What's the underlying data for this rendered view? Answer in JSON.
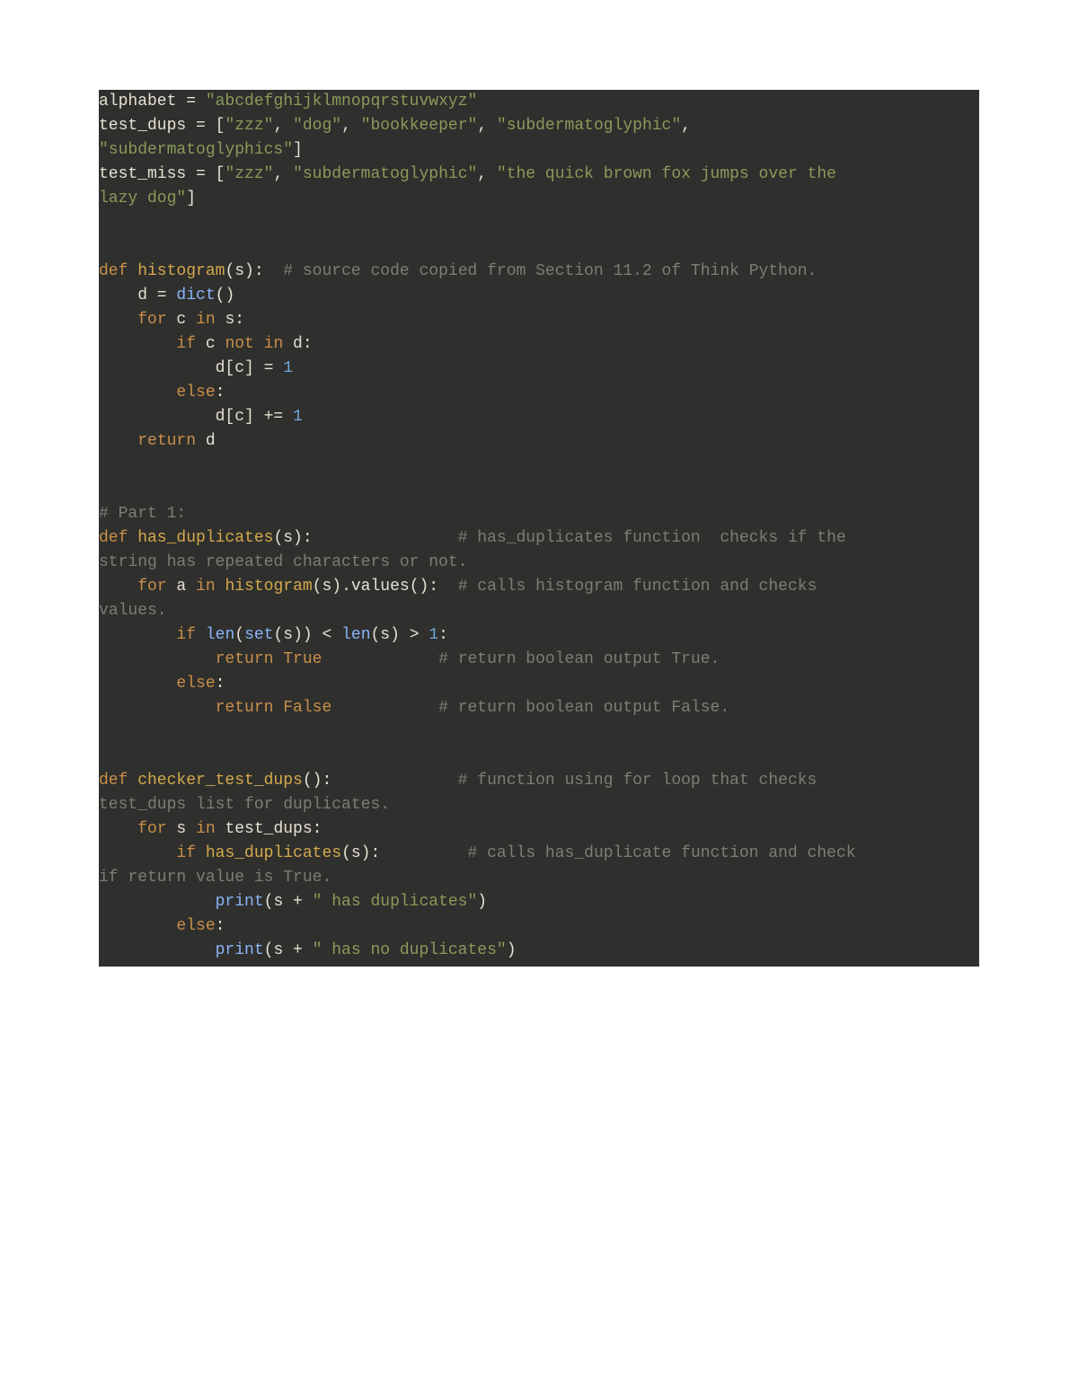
{
  "code": {
    "line1_var": "alphabet",
    "line1_eq": " = ",
    "line1_str": "\"abcdefghijklmnopqrstuvwxyz\"",
    "line2_var": "test_dups",
    "line2_eq": " = [",
    "line2_s1": "\"zzz\"",
    "line2_c1": ", ",
    "line2_s2": "\"dog\"",
    "line2_c2": ", ",
    "line2_s3": "\"bookkeeper\"",
    "line2_c3": ", ",
    "line2_s4": "\"subdermatoglyphic\"",
    "line2_c4": ", ",
    "line3_s5": "\"subdermatoglyphics\"",
    "line3_end": "]",
    "line4_var": "test_miss",
    "line4_eq": " = [",
    "line4_s1": "\"zzz\"",
    "line4_c1": ", ",
    "line4_s2": "\"subdermatoglyphic\"",
    "line4_c2": ", ",
    "line4_s3": "\"the quick brown fox jumps over the ",
    "line5_s3b": "lazy dog\"",
    "line5_end": "]",
    "def1_kw": "def",
    "def1_name": " histogram",
    "def1_sig": "(s):",
    "def1_cmt": "  # source code copied from Section 11.2 of Think Python.",
    "h1": "    d = ",
    "h1b": "dict",
    "h1c": "()",
    "h2a": "    ",
    "h2kw": "for",
    "h2b": " c ",
    "h2kw2": "in",
    "h2c": " s:",
    "h3a": "        ",
    "h3kw": "if",
    "h3b": " c ",
    "h3kw2": "not in",
    "h3c": " d:",
    "h4": "            d[c] = ",
    "h4n": "1",
    "h5a": "        ",
    "h5kw": "else",
    "h5b": ":",
    "h6": "            d[c] += ",
    "h6n": "1",
    "h7a": "    ",
    "h7kw": "return",
    "h7b": " d",
    "part1_cmt": "# Part 1:",
    "def2_kw": "def",
    "def2_name": " has_duplicates",
    "def2_sig": "(s):",
    "def2_pad": "               ",
    "def2_cmt": "# has_duplicates function  checks if the ",
    "def2_cmt2": "string has repeated characters or not.",
    "d2a": "    ",
    "d2kw": "for",
    "d2b": " a ",
    "d2kw2": "in",
    "d2c": " ",
    "d2fn": "histogram",
    "d2d": "(s).values():  ",
    "d2cmt": "# calls histogram function and checks ",
    "d2cmt2": "values.",
    "d3a": "        ",
    "d3kw": "if",
    "d3b": " ",
    "d3fn1": "len",
    "d3c": "(",
    "d3fn2": "set",
    "d3d": "(s)) < ",
    "d3fn3": "len",
    "d3e": "(s) > ",
    "d3n": "1",
    "d3f": ":",
    "d4a": "            ",
    "d4kw": "return",
    "d4b": " ",
    "d4const": "True",
    "d4pad": "            ",
    "d4cmt": "# return boolean output True.",
    "d5a": "        ",
    "d5kw": "else",
    "d5b": ":",
    "d6a": "            ",
    "d6kw": "return",
    "d6b": " ",
    "d6const": "False",
    "d6pad": "           ",
    "d6cmt": "# return boolean output False.",
    "def3_kw": "def",
    "def3_name": " checker_test_dups",
    "def3_sig": "():",
    "def3_pad": "             ",
    "def3_cmt": "# function using for loop that checks ",
    "def3_cmt2": "test_dups list for duplicates.",
    "c1a": "    ",
    "c1kw": "for",
    "c1b": " s ",
    "c1kw2": "in",
    "c1c": " test_dups:",
    "c2a": "        ",
    "c2kw": "if",
    "c2b": " ",
    "c2fn": "has_duplicates",
    "c2c": "(s):",
    "c2pad": "         ",
    "c2cmt": "# calls has_duplicate function and check ",
    "c2cmt2": "if return value is True.",
    "c3a": "            ",
    "c3fn": "print",
    "c3b": "(s + ",
    "c3str": "\" has duplicates\"",
    "c3c": ")",
    "c4a": "        ",
    "c4kw": "else",
    "c4b": ":",
    "c5a": "            ",
    "c5fn": "print",
    "c5b": "(s + ",
    "c5str": "\" has no duplicates\"",
    "c5c": ")"
  }
}
